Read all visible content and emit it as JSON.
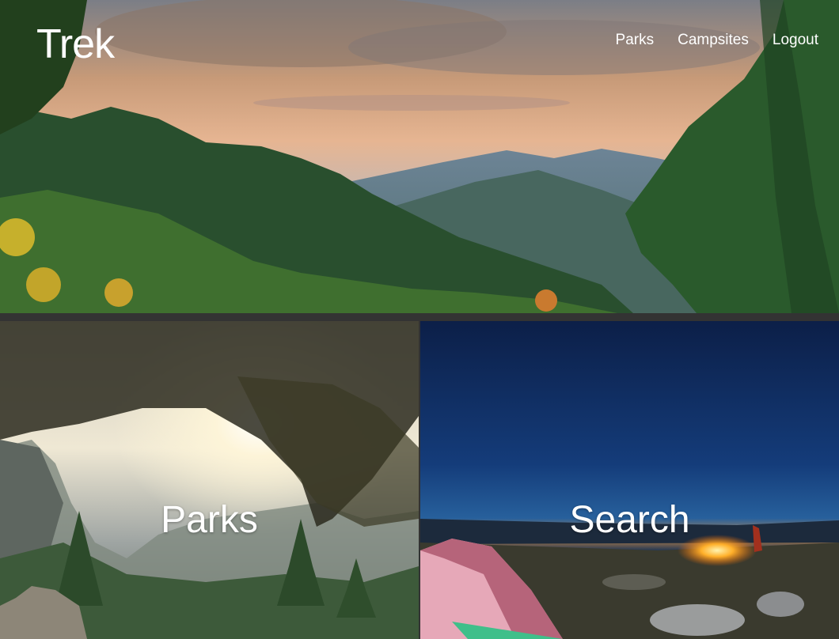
{
  "header": {
    "logo": "Trek",
    "nav": [
      {
        "label": "Parks"
      },
      {
        "label": "Campsites"
      },
      {
        "label": "Logout"
      }
    ]
  },
  "tiles": [
    {
      "label": "Parks"
    },
    {
      "label": "Search"
    }
  ]
}
